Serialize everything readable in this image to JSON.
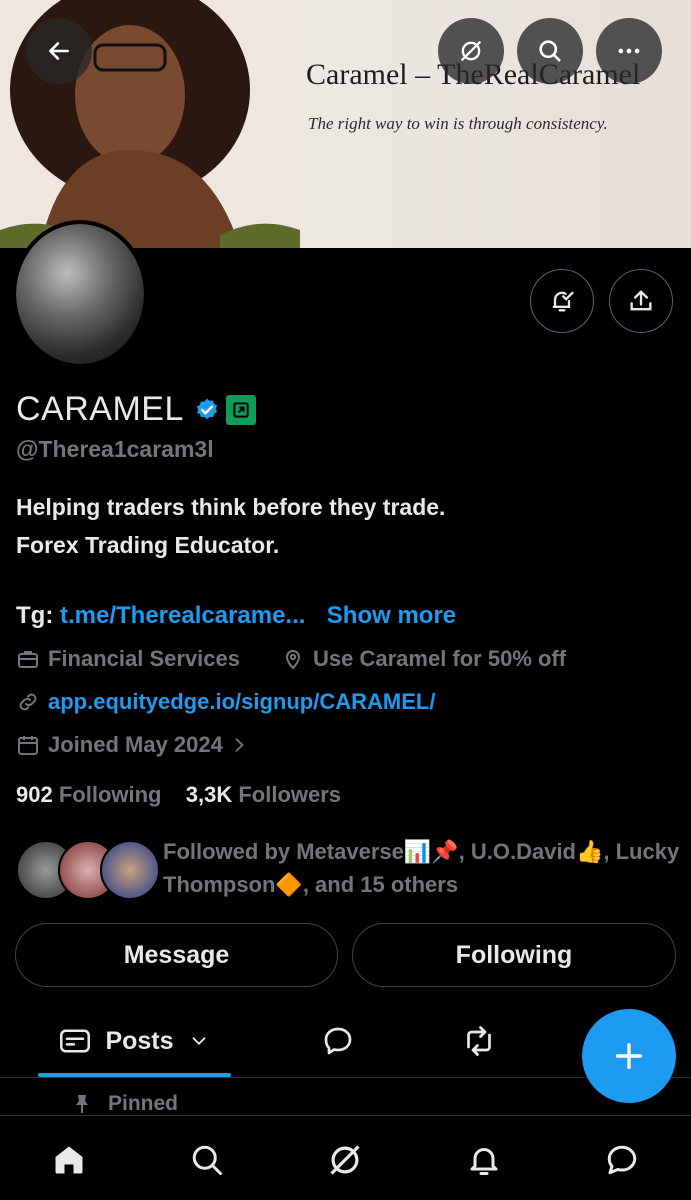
{
  "banner": {
    "title": "Caramel – TheRealCaramel",
    "tagline": "The right way to win is through consistency."
  },
  "profile": {
    "display_name": "CARAMEL",
    "handle": "@Therea1caram3l",
    "bio_line1": "Helping traders think before they trade.",
    "bio_line2": "Forex Trading Educator.",
    "tg_label": "Tg:",
    "tg_link": "t.me/Therealcarame...",
    "show_more": "Show more",
    "category": "Financial Services",
    "location": "Use Caramel for 50% off",
    "website": "app.equityedge.io/signup/CARAMEL/",
    "joined": "Joined May 2024",
    "following_count": "902",
    "following_label": "Following",
    "followers_count": "3,3K",
    "followers_label": "Followers",
    "followed_by": "Followed by Metaverse📊📌, U.O.David👍, Lucky Thompson🔶, and 15 others"
  },
  "actions": {
    "message": "Message",
    "following": "Following"
  },
  "tabs": {
    "posts": "Posts",
    "pinned": "Pinned"
  },
  "colors": {
    "accent": "#1d9bf0",
    "muted": "#71767b",
    "affiliate": "#0f9d58"
  },
  "icons": [
    "back-arrow-icon",
    "grok-icon",
    "search-icon",
    "more-icon",
    "notify-check-icon",
    "share-icon",
    "verified-icon",
    "affiliate-icon",
    "briefcase-icon",
    "location-icon",
    "link-icon",
    "calendar-icon",
    "chevron-right-icon",
    "posts-icon",
    "chevron-down-icon",
    "reply-icon",
    "repost-icon",
    "plus-icon",
    "pin-icon",
    "home-icon",
    "bell-icon",
    "message-icon"
  ]
}
